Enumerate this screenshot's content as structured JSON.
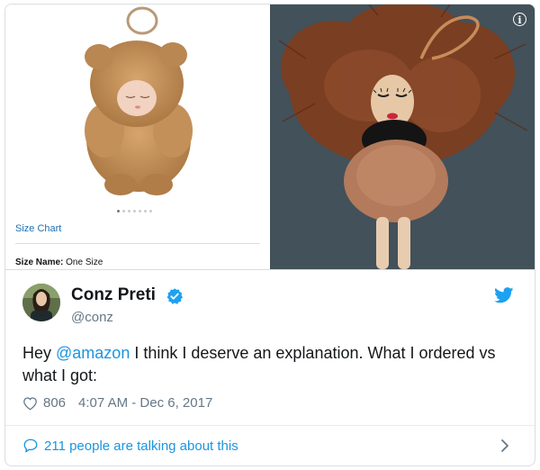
{
  "product_panel": {
    "size_chart_link": "Size Chart",
    "size_name_label": "Size Name:",
    "size_name_value": "One Size",
    "carousel_dots": 7,
    "carousel_active": 0
  },
  "tweet": {
    "author_name": "Conz Preti",
    "author_handle": "@conz",
    "text_before": "Hey ",
    "mention": "@amazon",
    "text_after": " I think I deserve an explanation. What I ordered vs what I got:",
    "like_count": "806",
    "timestamp": "4:07 AM - Dec 6, 2017",
    "conversation_link": "211 people are talking about this"
  },
  "colors": {
    "link_blue": "#1b95e0",
    "verified_blue": "#1da1f2",
    "muted_text": "#657786",
    "amazon_link": "#1f6fb2"
  },
  "icons": [
    "info-icon",
    "verified-badge-icon",
    "twitter-bird-icon",
    "heart-icon",
    "speech-bubble-icon",
    "chevron-right-icon"
  ]
}
